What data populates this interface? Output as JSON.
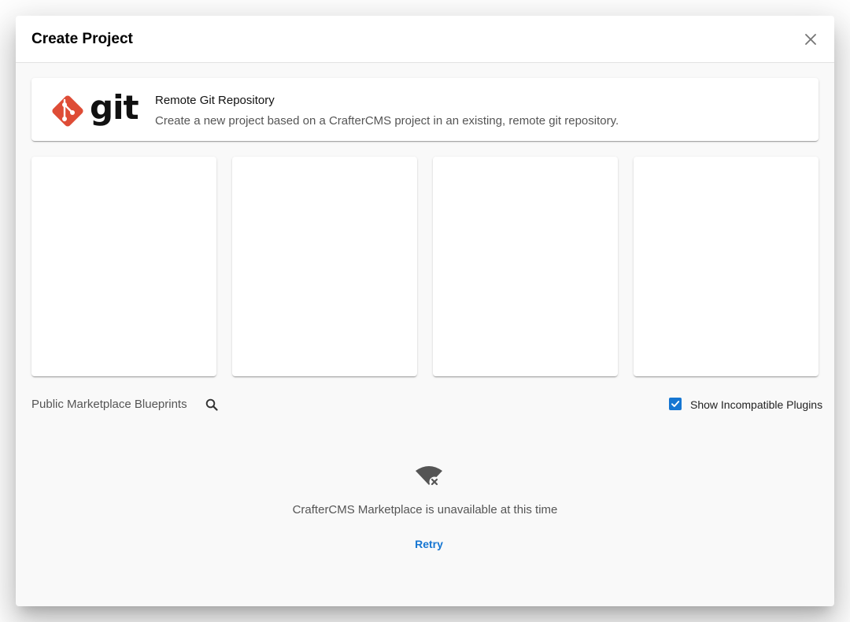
{
  "dialog": {
    "title": "Create Project",
    "close_icon": "close-icon"
  },
  "git_option": {
    "logo_icon": "git-logo",
    "logo_text": "git",
    "title": "Remote Git Repository",
    "description": "Create a new project based on a CrafterCMS project in an existing, remote git repository."
  },
  "blueprint_cards": [
    {
      "label": ""
    },
    {
      "label": ""
    },
    {
      "label": ""
    },
    {
      "label": ""
    }
  ],
  "marketplace": {
    "section_label": "Public Marketplace Blueprints",
    "search_icon": "search-icon",
    "show_incompatible": {
      "label": "Show Incompatible Plugins",
      "checked": true
    },
    "empty_state": {
      "icon": "wifi-off-icon",
      "message": "CrafterCMS Marketplace is unavailable at this time",
      "retry_label": "Retry"
    }
  },
  "colors": {
    "accent": "#1676d2",
    "git_brand": "#de4c36",
    "dialog_bg": "#f9f9f9"
  }
}
